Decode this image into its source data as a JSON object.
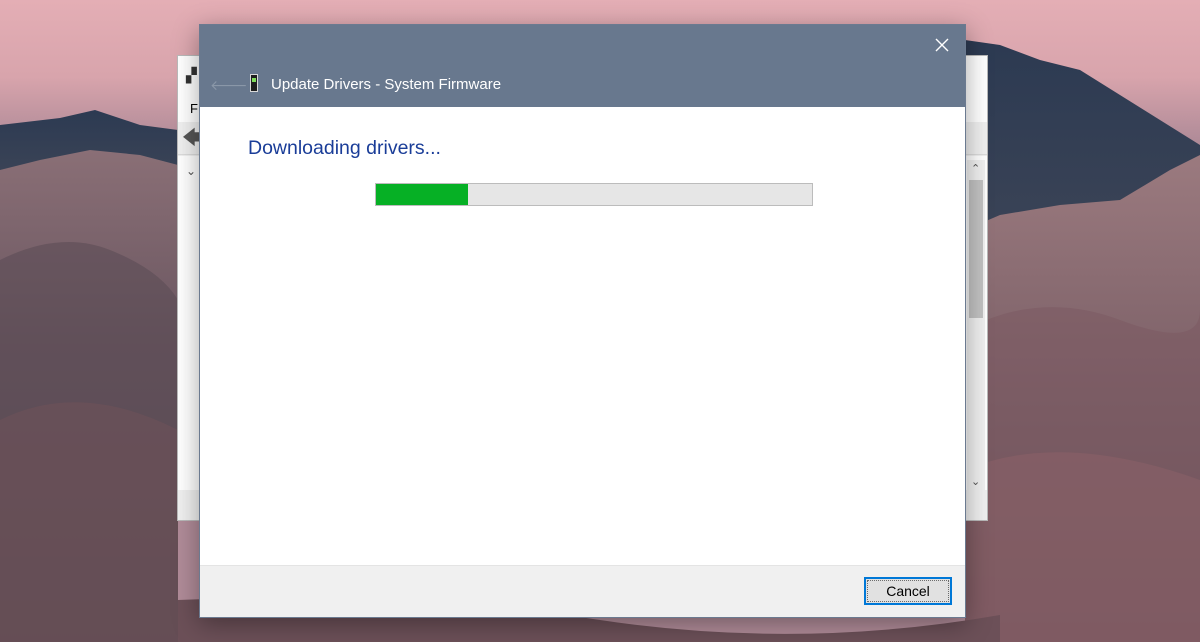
{
  "background_window": {
    "menu_file_label": "F",
    "app_icon": "device-manager-icon",
    "back_icon": "back-arrow-icon",
    "chevron_icon": "chevron-down-icon",
    "scroll_up_icon": "scroll-up-icon",
    "scroll_down_icon": "scroll-down-icon"
  },
  "dialog": {
    "close_icon": "close-icon",
    "back_icon": "back-arrow-icon",
    "device_icon": "system-firmware-icon",
    "header_title": "Update Drivers - System Firmware",
    "status_heading": "Downloading drivers...",
    "progress_percent": 21,
    "cancel_label": "Cancel"
  },
  "colors": {
    "titlebar": "#68788e",
    "heading_text": "#1a3d98",
    "progress_fill": "#06b025",
    "progress_track": "#e6e6e6",
    "button_focus_border": "#0078d7"
  }
}
